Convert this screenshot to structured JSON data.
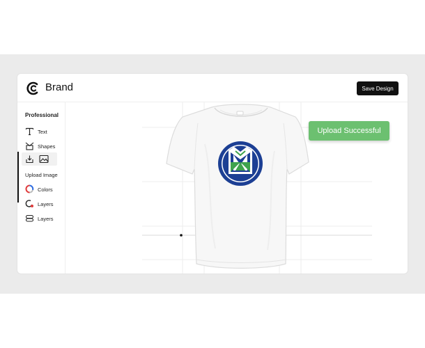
{
  "header": {
    "brand": "Brand",
    "save_label": "Save Design"
  },
  "sidebar": {
    "title": "Professional",
    "items": [
      {
        "label": "Text",
        "icon": "text-icon"
      },
      {
        "label": "Shapes",
        "icon": "shapes-icon"
      },
      {
        "label": "",
        "icon": "upload-icon"
      },
      {
        "label": "Upload Image",
        "icon": "image-icon"
      },
      {
        "label": "Colors",
        "icon": "colors-icon"
      },
      {
        "label": "Layers",
        "icon": "layers-icon"
      },
      {
        "label": "Layers",
        "icon": "layers-stack-icon"
      }
    ]
  },
  "toast": {
    "message": "Upload Successful",
    "color": "#6cc070"
  },
  "colors": {
    "logo_blue": "#1c3f94",
    "logo_green": "#3fa34d",
    "accent_dark": "#111111"
  }
}
